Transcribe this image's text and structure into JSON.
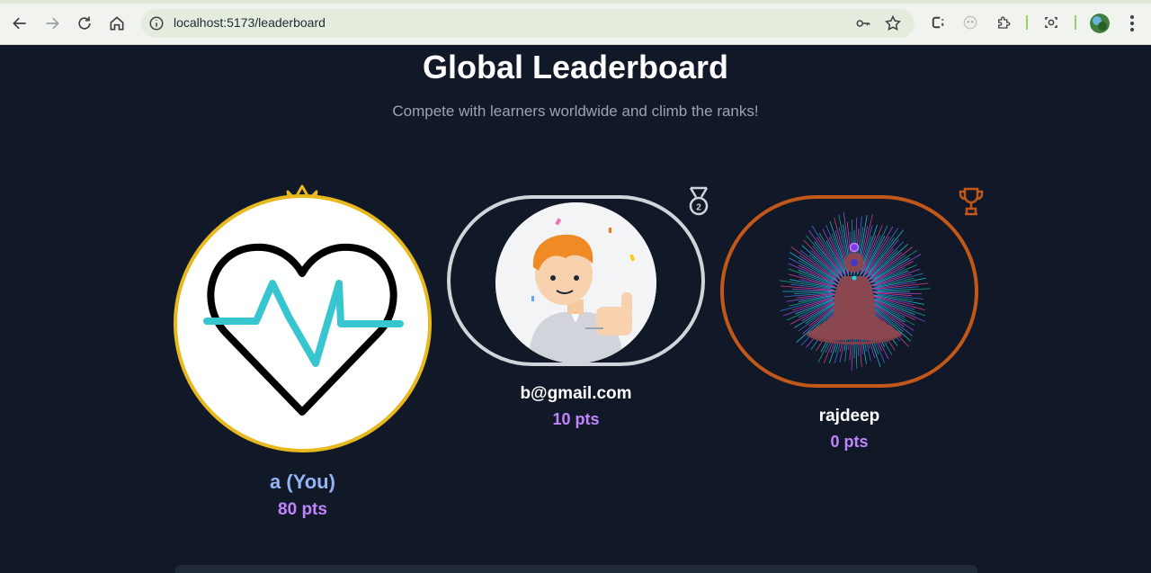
{
  "browser": {
    "url": "localhost:5173/leaderboard",
    "accent": "#9ad06a"
  },
  "page": {
    "title": "Global Leaderboard",
    "subtitle": "Compete with learners worldwide and climb the ranks!",
    "background": "#111827"
  },
  "leaderboard": [
    {
      "rank": 1,
      "name": "a (You)",
      "points": "80 pts",
      "badge": "crown-icon",
      "ring_color": "#e8b91f",
      "avatar": "heartbeat-avatar"
    },
    {
      "rank": 2,
      "name": "b@gmail.com",
      "points": "10 pts",
      "badge": "medal-icon",
      "ring_color": "#d1d5db",
      "avatar": "cartoon-boy-thumbs-up-avatar"
    },
    {
      "rank": 3,
      "name": "rajdeep",
      "points": "0 pts",
      "badge": "trophy-icon",
      "ring_color": "#c2571a",
      "avatar": "meditation-avatar"
    }
  ],
  "colors": {
    "points": "#c084fc",
    "current_user_name": "#93b4f5"
  }
}
